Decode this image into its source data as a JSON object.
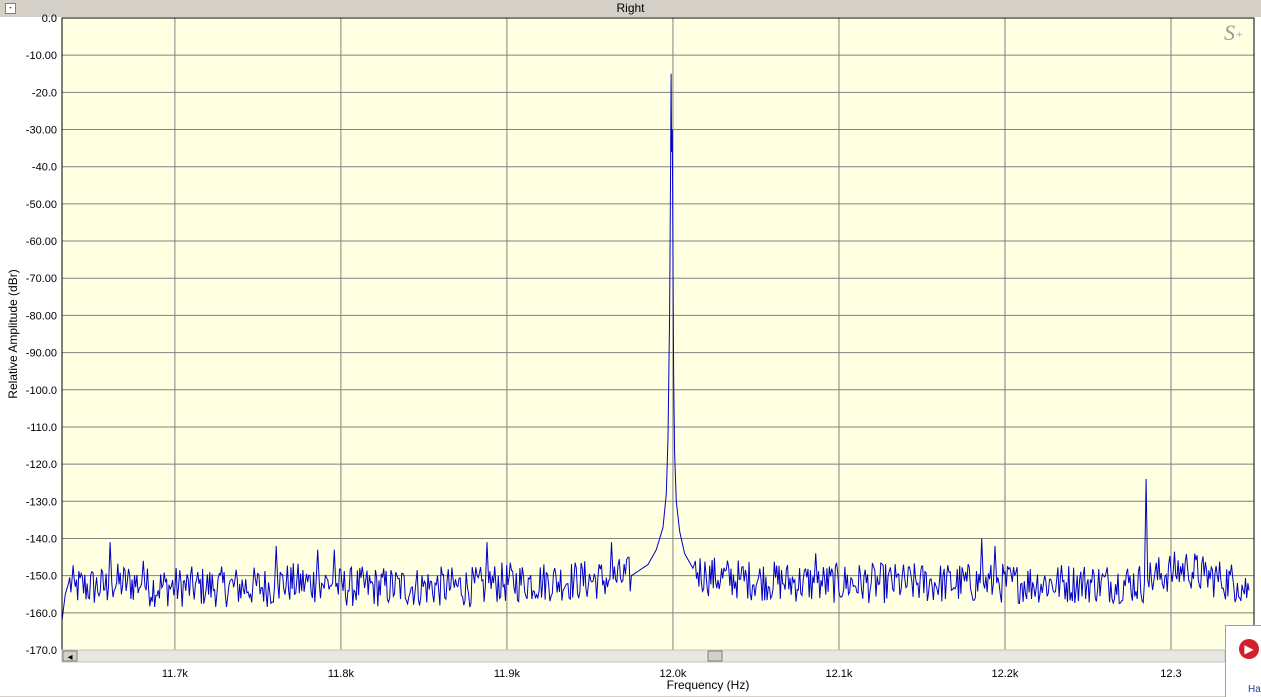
{
  "window": {
    "collapse_glyph": "-",
    "collapse_icon": "minus-box-icon"
  },
  "watermark": {
    "text": "S",
    "suffix": "+"
  },
  "corner_widget": {
    "icon": "play-circle-icon",
    "glyph": "▶",
    "label": "Ha"
  },
  "scrollbar": {
    "left_arrow_glyph": "◂",
    "left_arrow_icon": "scroll-left-arrow-icon"
  },
  "colors": {
    "plot_bg": "#ffffe1",
    "series": "#0000c8",
    "grid": "#808080"
  },
  "chart_data": {
    "type": "line",
    "title": "Right",
    "xlabel": "Frequency (Hz)",
    "ylabel": "Relative Amplitude (dBr)",
    "xlim": [
      11632,
      12350
    ],
    "ylim": [
      -170,
      0
    ],
    "x_ticks": [
      11700,
      11800,
      11900,
      12000,
      12100,
      12200,
      12300
    ],
    "x_tick_labels": [
      "11.7k",
      "11.8k",
      "11.9k",
      "12.0k",
      "12.1k",
      "12.2k",
      "12.3"
    ],
    "y_ticks": [
      0,
      -10,
      -20,
      -30,
      -40,
      -50,
      -60,
      -70,
      -80,
      -90,
      -100,
      -110,
      -120,
      -130,
      -140,
      -150,
      -160,
      -170
    ],
    "y_tick_labels": [
      "0.0",
      "-10.00",
      "-20.0",
      "-30.00",
      "-40.0",
      "-50.00",
      "-60.00",
      "-70.00",
      "-80.00",
      "-90.00",
      "-100.0",
      "-110.0",
      "-120.0",
      "-130.0",
      "-140.0",
      "-150.0",
      "-160.0",
      "-170.0"
    ],
    "grid": true,
    "legend": "none",
    "noise_floor": -152,
    "series": [
      {
        "points": [
          [
            11632,
            -162
          ],
          [
            11634,
            -155
          ],
          [
            11636,
            -152
          ],
          [
            11640,
            -153
          ],
          [
            11660,
            -153
          ],
          [
            11661,
            -141
          ],
          [
            11662,
            -152
          ],
          [
            11680,
            -152
          ],
          [
            11681,
            -146
          ],
          [
            11682,
            -153
          ],
          [
            11760,
            -153
          ],
          [
            11761,
            -142
          ],
          [
            11762,
            -152
          ],
          [
            11785,
            -152
          ],
          [
            11786,
            -143
          ],
          [
            11787,
            -152
          ],
          [
            11795,
            -152
          ],
          [
            11796,
            -143
          ],
          [
            11797,
            -153
          ],
          [
            11887,
            -153
          ],
          [
            11888,
            -141
          ],
          [
            11889,
            -152
          ],
          [
            11962,
            -151
          ],
          [
            11963,
            -141
          ],
          [
            11964,
            -151
          ],
          [
            11975,
            -150
          ],
          [
            11985,
            -147
          ],
          [
            11990,
            -143
          ],
          [
            11994,
            -137
          ],
          [
            11996,
            -128
          ],
          [
            11997,
            -113
          ],
          [
            11998,
            -80
          ],
          [
            11998.6,
            -40
          ],
          [
            11998.9,
            -15
          ],
          [
            11999.2,
            -36
          ],
          [
            11999.6,
            -30
          ],
          [
            12000,
            -60
          ],
          [
            12000.4,
            -95
          ],
          [
            12001,
            -117
          ],
          [
            12002,
            -130
          ],
          [
            12004,
            -138
          ],
          [
            12007,
            -144
          ],
          [
            12012,
            -148
          ],
          [
            12020,
            -150
          ],
          [
            12040,
            -151
          ],
          [
            12085,
            -152
          ],
          [
            12086,
            -144
          ],
          [
            12087,
            -152
          ],
          [
            12185,
            -152
          ],
          [
            12186,
            -140
          ],
          [
            12187,
            -152
          ],
          [
            12193,
            -152
          ],
          [
            12194,
            -142
          ],
          [
            12195,
            -152
          ],
          [
            12284,
            -152
          ],
          [
            12285,
            -124
          ],
          [
            12286,
            -151
          ],
          [
            12300,
            -149
          ],
          [
            12310,
            -148
          ],
          [
            12320,
            -150
          ],
          [
            12330,
            -151
          ],
          [
            12340,
            -152
          ],
          [
            12347,
            -154
          ]
        ]
      }
    ]
  }
}
